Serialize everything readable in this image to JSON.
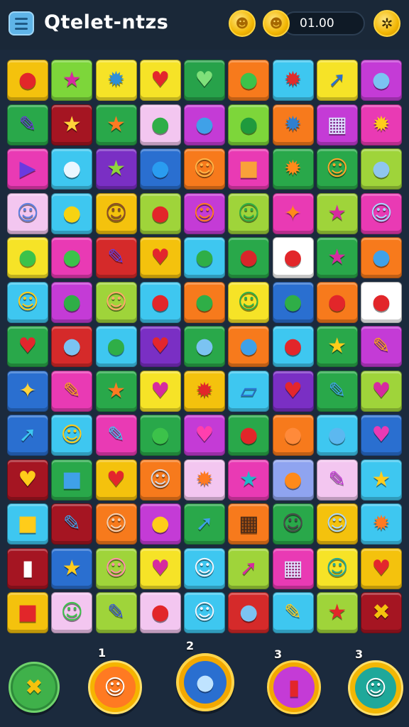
{
  "header": {
    "title": "Qtelet-ntzs",
    "score": "01.00",
    "menu_icon": "hamburger-menu-icon",
    "coin_icons": [
      "gold-coin-icon",
      "gold-coin-icon"
    ],
    "settings_icon": "settings-badge-icon",
    "coin_glyphs": [
      "☻",
      "☻"
    ],
    "settings_glyph": "✲"
  },
  "board": {
    "rows": 13,
    "cols": 9,
    "tiles": [
      [
        {
          "bg": "#f4c20d",
          "icon": "red-balloon",
          "glyph": "●",
          "color": "#e2262a"
        },
        {
          "bg": "#7dd63a",
          "icon": "magenta-star",
          "glyph": "★",
          "color": "#d62aa0"
        },
        {
          "bg": "#f6e327",
          "icon": "blue-gear",
          "glyph": "✹",
          "color": "#2e8fd8"
        },
        {
          "bg": "#f6e327",
          "icon": "red-heart",
          "glyph": "♥",
          "color": "#e3262d"
        },
        {
          "bg": "#27a24a",
          "icon": "green-heart",
          "glyph": "♥",
          "color": "#7fe07a"
        },
        {
          "bg": "#f77a1c",
          "icon": "green-speech-bubble",
          "glyph": "●",
          "color": "#3cc24a"
        },
        {
          "bg": "#3ec7f0",
          "icon": "red-sun",
          "glyph": "✹",
          "color": "#e02c2c"
        },
        {
          "bg": "#f6e327",
          "icon": "blue-rocket",
          "glyph": "➚",
          "color": "#2a6fd0"
        },
        {
          "bg": "#c43bd6",
          "icon": "magnifier",
          "glyph": "●",
          "color": "#7bc3f2"
        }
      ],
      [
        {
          "bg": "#29a84a",
          "icon": "purple-pencil",
          "glyph": "✎",
          "color": "#6a3ad8"
        },
        {
          "bg": "#a51522",
          "icon": "yellow-star",
          "glyph": "★",
          "color": "#ffd43a"
        },
        {
          "bg": "#29a84a",
          "icon": "orange-star",
          "glyph": "★",
          "color": "#ff7a22"
        },
        {
          "bg": "#f3c6f0",
          "icon": "green-speech-bubble",
          "glyph": "●",
          "color": "#2fae47"
        },
        {
          "bg": "#c43bd6",
          "icon": "blue-speech-bubble",
          "glyph": "●",
          "color": "#3fa1e8"
        },
        {
          "bg": "#7dd63a",
          "icon": "green-speech-bubble",
          "glyph": "●",
          "color": "#1f9a3d"
        },
        {
          "bg": "#f77a1c",
          "icon": "blue-gear",
          "glyph": "✹",
          "color": "#2e7fd0"
        },
        {
          "bg": "#c43bd6",
          "icon": "blocks",
          "glyph": "▦",
          "color": "#dfe9ff"
        },
        {
          "bg": "#e93ab4",
          "icon": "yellow-sun",
          "glyph": "✹",
          "color": "#ffcc1a"
        }
      ],
      [
        {
          "bg": "#e93ab4",
          "icon": "play-triangle",
          "glyph": "▶",
          "color": "#6a3ae0"
        },
        {
          "bg": "#3ec7f0",
          "icon": "white-speech-bubble",
          "glyph": "●",
          "color": "#eaf6ff"
        },
        {
          "bg": "#7a2fc4",
          "icon": "green-star",
          "glyph": "★",
          "color": "#8fd63a"
        },
        {
          "bg": "#2a6fd0",
          "icon": "blue-balloon",
          "glyph": "●",
          "color": "#2a9cf0"
        },
        {
          "bg": "#f77a1c",
          "icon": "orange-smiley",
          "glyph": "☺",
          "color": "#ffb347"
        },
        {
          "bg": "#e93ab4",
          "icon": "orange-robot",
          "glyph": "■",
          "color": "#f9a13a"
        },
        {
          "bg": "#29a84a",
          "icon": "orange-gear",
          "glyph": "✹",
          "color": "#ff8a1a"
        },
        {
          "bg": "#29a84a",
          "icon": "orange-smiley",
          "glyph": "☺",
          "color": "#ffa52b"
        },
        {
          "bg": "#9fd43a",
          "icon": "blue-magnifier",
          "glyph": "●",
          "color": "#8fc6ee"
        }
      ],
      [
        {
          "bg": "#f3c6f0",
          "icon": "blue-monster",
          "glyph": "☺",
          "color": "#5c7fe0"
        },
        {
          "bg": "#3ec7f0",
          "icon": "yellow-lemon",
          "glyph": "●",
          "color": "#f6d312"
        },
        {
          "bg": "#f4c20d",
          "icon": "avatar-face",
          "glyph": "☺",
          "color": "#8a4b2a"
        },
        {
          "bg": "#9fd43a",
          "icon": "red-balloon",
          "glyph": "●",
          "color": "#e2262a"
        },
        {
          "bg": "#c43bd6",
          "icon": "orange-smiley",
          "glyph": "☺",
          "color": "#ff7a22"
        },
        {
          "bg": "#9fd43a",
          "icon": "green-robot",
          "glyph": "☺",
          "color": "#2fae47"
        },
        {
          "bg": "#e93ab4",
          "icon": "orange-star",
          "glyph": "✦",
          "color": "#ff8a1a"
        },
        {
          "bg": "#9fd43a",
          "icon": "magenta-star",
          "glyph": "★",
          "color": "#d62aa0"
        },
        {
          "bg": "#e93ab4",
          "icon": "blue-smiley",
          "glyph": "☺",
          "color": "#a9d7ff"
        }
      ],
      [
        {
          "bg": "#f6e327",
          "icon": "green-blob",
          "glyph": "●",
          "color": "#3cc24a"
        },
        {
          "bg": "#e93ab4",
          "icon": "green-leaf",
          "glyph": "●",
          "color": "#3cc24a"
        },
        {
          "bg": "#d52a2a",
          "icon": "pencil",
          "glyph": "✎",
          "color": "#6a3ad8"
        },
        {
          "bg": "#f4c20d",
          "icon": "red-heart",
          "glyph": "♥",
          "color": "#e3262d"
        },
        {
          "bg": "#3ec7f0",
          "icon": "green-bird",
          "glyph": "●",
          "color": "#2fae47"
        },
        {
          "bg": "#29a84a",
          "icon": "red-balloon",
          "glyph": "●",
          "color": "#d8262a"
        },
        {
          "bg": "#ffffff",
          "icon": "red-apple",
          "glyph": "●",
          "color": "#e2262a"
        },
        {
          "bg": "#29a84a",
          "icon": "magenta-star",
          "glyph": "★",
          "color": "#d62aa0"
        },
        {
          "bg": "#f77a1c",
          "icon": "blue-cloud",
          "glyph": "●",
          "color": "#3fa1e8"
        }
      ],
      [
        {
          "bg": "#3ec7f0",
          "icon": "yellow-smiley",
          "glyph": "☺",
          "color": "#ffcc1a"
        },
        {
          "bg": "#c43bd6",
          "icon": "green-speech-bubble",
          "glyph": "●",
          "color": "#2fae47"
        },
        {
          "bg": "#9fd43a",
          "icon": "orange-smiley",
          "glyph": "☺",
          "color": "#ffa86b"
        },
        {
          "bg": "#3ec7f0",
          "icon": "red-balloon",
          "glyph": "●",
          "color": "#e2262a"
        },
        {
          "bg": "#f77a1c",
          "icon": "green-speech-bubble",
          "glyph": "●",
          "color": "#2fae47"
        },
        {
          "bg": "#f6e327",
          "icon": "green-monster",
          "glyph": "☺",
          "color": "#2fae47"
        },
        {
          "bg": "#2a6fd0",
          "icon": "green-speech-bubble",
          "glyph": "●",
          "color": "#2fae47"
        },
        {
          "bg": "#f77a1c",
          "icon": "red-blob",
          "glyph": "●",
          "color": "#e2262a"
        },
        {
          "bg": "#ffffff",
          "icon": "red-speech-bubble",
          "glyph": "●",
          "color": "#e2262a"
        }
      ],
      [
        {
          "bg": "#29a84a",
          "icon": "red-heart",
          "glyph": "♥",
          "color": "#e3262d"
        },
        {
          "bg": "#d52a2a",
          "icon": "blue-speech-bubble",
          "glyph": "●",
          "color": "#7bc3f2"
        },
        {
          "bg": "#3ec7f0",
          "icon": "green-cloud",
          "glyph": "●",
          "color": "#2fae47"
        },
        {
          "bg": "#7a2fc4",
          "icon": "red-heart",
          "glyph": "♥",
          "color": "#e3262d"
        },
        {
          "bg": "#29a84a",
          "icon": "blue-balloon",
          "glyph": "●",
          "color": "#7bc3f2"
        },
        {
          "bg": "#f77a1c",
          "icon": "blue-balloon",
          "glyph": "●",
          "color": "#3fa1e8"
        },
        {
          "bg": "#3ec7f0",
          "icon": "red-balloon",
          "glyph": "●",
          "color": "#e2262a"
        },
        {
          "bg": "#29a84a",
          "icon": "yellow-star",
          "glyph": "★",
          "color": "#ffcc1a"
        },
        {
          "bg": "#c43bd6",
          "icon": "pencil",
          "glyph": "✎",
          "color": "#f7a21c"
        }
      ],
      [
        {
          "bg": "#2a6fd0",
          "icon": "yellow-star",
          "glyph": "✦",
          "color": "#ffd43a"
        },
        {
          "bg": "#e93ab4",
          "icon": "paintbrush",
          "glyph": "✎",
          "color": "#f7a21c"
        },
        {
          "bg": "#29a84a",
          "icon": "orange-star",
          "glyph": "★",
          "color": "#ff7a22"
        },
        {
          "bg": "#f6e327",
          "icon": "magenta-heart",
          "glyph": "♥",
          "color": "#d62aa0"
        },
        {
          "bg": "#f4c20d",
          "icon": "crossed-tools",
          "glyph": "✹",
          "color": "#e2262a"
        },
        {
          "bg": "#3ec7f0",
          "icon": "ticket",
          "glyph": "▱",
          "color": "#2a6fd0"
        },
        {
          "bg": "#7a2fc4",
          "icon": "red-heart",
          "glyph": "♥",
          "color": "#e3262d"
        },
        {
          "bg": "#29a84a",
          "icon": "blue-pencil",
          "glyph": "✎",
          "color": "#3fa1e8"
        },
        {
          "bg": "#9fd43a",
          "icon": "magenta-heart",
          "glyph": "♥",
          "color": "#d62aa0"
        }
      ],
      [
        {
          "bg": "#2a6fd0",
          "icon": "rocket",
          "glyph": "➚",
          "color": "#3ec7f0"
        },
        {
          "bg": "#3ec7f0",
          "icon": "yellow-smiley",
          "glyph": "☺",
          "color": "#ffcc1a"
        },
        {
          "bg": "#e93ab4",
          "icon": "blue-pencil",
          "glyph": "✎",
          "color": "#3ec7f0"
        },
        {
          "bg": "#29a84a",
          "icon": "green-pear",
          "glyph": "●",
          "color": "#3cc24a"
        },
        {
          "bg": "#c43bd6",
          "icon": "magenta-heart",
          "glyph": "♥",
          "color": "#ff3fae"
        },
        {
          "bg": "#29a84a",
          "icon": "red-capsule",
          "glyph": "●",
          "color": "#e2262a"
        },
        {
          "bg": "#f77a1c",
          "icon": "orange-blob",
          "glyph": "●",
          "color": "#ff8a3a"
        },
        {
          "bg": "#3ec7f0",
          "icon": "blue-cloud",
          "glyph": "●",
          "color": "#5cb8f0"
        },
        {
          "bg": "#2a6fd0",
          "icon": "magenta-heart",
          "glyph": "♥",
          "color": "#e93ab4"
        }
      ],
      [
        {
          "bg": "#a51522",
          "icon": "yellow-heart",
          "glyph": "♥",
          "color": "#ffcc1a"
        },
        {
          "bg": "#29a84a",
          "icon": "blue-box",
          "glyph": "■",
          "color": "#3fa1e8"
        },
        {
          "bg": "#f4c20d",
          "icon": "red-heart",
          "glyph": "♥",
          "color": "#e3262d"
        },
        {
          "bg": "#f77a1c",
          "icon": "robot-face",
          "glyph": "☺",
          "color": "#d8d8e0"
        },
        {
          "bg": "#f3c6f0",
          "icon": "orange-sun",
          "glyph": "✹",
          "color": "#ff7a22"
        },
        {
          "bg": "#e93ab4",
          "icon": "teal-star",
          "glyph": "★",
          "color": "#20b8c8"
        },
        {
          "bg": "#8fa4f0",
          "icon": "orange-bird",
          "glyph": "●",
          "color": "#ff8a1a"
        },
        {
          "bg": "#f3c6f0",
          "icon": "paintbrush",
          "glyph": "✎",
          "color": "#c43bd6"
        },
        {
          "bg": "#3ec7f0",
          "icon": "yellow-star",
          "glyph": "★",
          "color": "#ffcc1a"
        }
      ],
      [
        {
          "bg": "#3ec7f0",
          "icon": "yellow-robot",
          "glyph": "■",
          "color": "#ffcc1a"
        },
        {
          "bg": "#a51522",
          "icon": "pencil",
          "glyph": "✎",
          "color": "#3fa1e8"
        },
        {
          "bg": "#f77a1c",
          "icon": "boy-face",
          "glyph": "☺",
          "color": "#f3d1b4"
        },
        {
          "bg": "#c43bd6",
          "icon": "yellow-speech-bubble",
          "glyph": "●",
          "color": "#ffcc1a"
        },
        {
          "bg": "#29a84a",
          "icon": "blue-hook",
          "glyph": "➚",
          "color": "#3fa1e8"
        },
        {
          "bg": "#f77a1c",
          "icon": "window-grid",
          "glyph": "▦",
          "color": "#4a2a18"
        },
        {
          "bg": "#29a84a",
          "icon": "robot-face",
          "glyph": "☺",
          "color": "#4a4a4a"
        },
        {
          "bg": "#f4c20d",
          "icon": "blue-smiley",
          "glyph": "☺",
          "color": "#a9d7ff"
        },
        {
          "bg": "#3ec7f0",
          "icon": "orange-sun",
          "glyph": "✹",
          "color": "#ff7a22"
        }
      ],
      [
        {
          "bg": "#a51522",
          "icon": "battery",
          "glyph": "▮",
          "color": "#ffffff"
        },
        {
          "bg": "#2a6fd0",
          "icon": "yellow-star",
          "glyph": "★",
          "color": "#ffcc1a"
        },
        {
          "bg": "#9fd43a",
          "icon": "pink-smiley",
          "glyph": "☺",
          "color": "#ff8fa8"
        },
        {
          "bg": "#f6e327",
          "icon": "magenta-heart",
          "glyph": "♥",
          "color": "#d62aa0"
        },
        {
          "bg": "#3ec7f0",
          "icon": "white-smiley",
          "glyph": "☺",
          "color": "#eef6ff"
        },
        {
          "bg": "#9fd43a",
          "icon": "paper-plane",
          "glyph": "➚",
          "color": "#d62aa0"
        },
        {
          "bg": "#e93ab4",
          "icon": "waffle-badge",
          "glyph": "▦",
          "color": "#dfe9ff"
        },
        {
          "bg": "#f6e327",
          "icon": "teal-smiley",
          "glyph": "☺",
          "color": "#1fa89a"
        },
        {
          "bg": "#f4c20d",
          "icon": "red-heart",
          "glyph": "♥",
          "color": "#e3262d"
        }
      ],
      [
        {
          "bg": "#f4c20d",
          "icon": "red-robot",
          "glyph": "■",
          "color": "#e2262a"
        },
        {
          "bg": "#f3c6f0",
          "icon": "green-smiley",
          "glyph": "☺",
          "color": "#3cc24a"
        },
        {
          "bg": "#9fd43a",
          "icon": "pencil",
          "glyph": "✎",
          "color": "#3a5ad8"
        },
        {
          "bg": "#f3c6f0",
          "icon": "red-balloon",
          "glyph": "●",
          "color": "#e2262a"
        },
        {
          "bg": "#3ec7f0",
          "icon": "white-smiley",
          "glyph": "☺",
          "color": "#eef6ff"
        },
        {
          "bg": "#d52a2a",
          "icon": "blue-speech-bubble",
          "glyph": "●",
          "color": "#7bc3f2"
        },
        {
          "bg": "#3ec7f0",
          "icon": "magic-wand",
          "glyph": "✎",
          "color": "#ffcc1a"
        },
        {
          "bg": "#9fd43a",
          "icon": "red-star",
          "glyph": "★",
          "color": "#e2262a"
        },
        {
          "bg": "#a51522",
          "icon": "crossed-badge",
          "glyph": "✖",
          "color": "#f4c20d"
        }
      ]
    ]
  },
  "powerups": [
    {
      "name": "hammer-powerup",
      "icon": "crossed-tools-icon",
      "glyph": "✖",
      "count": "",
      "face_bg": "#3fb14a",
      "glyph_color": "#f4c20d"
    },
    {
      "name": "smiley-powerup",
      "icon": "orange-smiley-icon",
      "glyph": "☺",
      "count": "1",
      "face_bg": "#ff7a22",
      "glyph_color": "#ffffff"
    },
    {
      "name": "speech-bubble-powerup",
      "icon": "speech-bubble-icon",
      "glyph": "●",
      "count": "2",
      "face_bg": "#2a6fd0",
      "glyph_color": "#bfe3ff"
    },
    {
      "name": "battery-powerup",
      "icon": "battery-icon",
      "glyph": "▮",
      "count": "3",
      "face_bg": "#c43bd6",
      "glyph_color": "#e2262a"
    },
    {
      "name": "face-powerup",
      "icon": "white-face-icon",
      "glyph": "☺",
      "count": "3",
      "face_bg": "#1fa89a",
      "glyph_color": "#ffffff"
    }
  ]
}
